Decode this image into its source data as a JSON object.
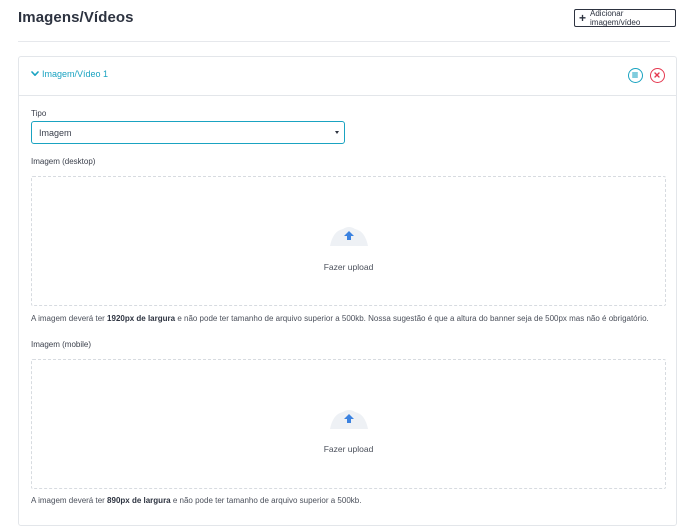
{
  "header": {
    "title": "Imagens/Vídeos",
    "add_button_label": "Adicionar imagem/vídeo",
    "add_icon": "plus-icon"
  },
  "item": {
    "title": "Imagem/Vídeo 1",
    "toggle_icon": "chevron-down-icon",
    "menu_icon": "menu-icon",
    "remove_icon": "close-icon",
    "accent_color": "#1aa3c1",
    "danger_color": "#e53950"
  },
  "form": {
    "type_label": "Tipo",
    "type_value": "Imagem",
    "desktop": {
      "label": "Imagem (desktop)",
      "upload_text": "Fazer upload",
      "hint_prefix": "A imagem deverá ter ",
      "hint_bold": "1920px de largura",
      "hint_suffix": " e não pode ter tamanho de arquivo superior a 500kb. Nossa sugestão é que a altura do banner seja de 500px mas não é obrigatório."
    },
    "mobile": {
      "label": "Imagem (mobile)",
      "upload_text": "Fazer upload",
      "hint_prefix": "A imagem deverá ter ",
      "hint_bold": "890px de largura",
      "hint_suffix": " e não pode ter tamanho de arquivo superior a 500kb."
    }
  }
}
